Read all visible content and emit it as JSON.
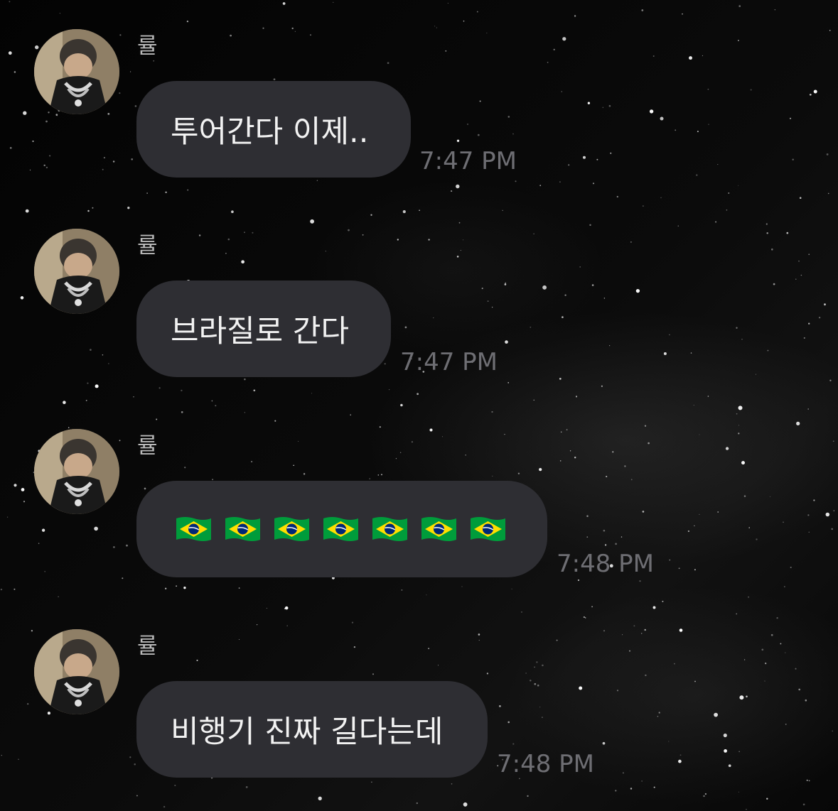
{
  "messages": [
    {
      "sender": "률",
      "text": "투어간다 이제..",
      "time": "7:47 PM"
    },
    {
      "sender": "률",
      "text": "브라질로 간다",
      "time": "7:47 PM"
    },
    {
      "sender": "률",
      "emoji_flags": [
        "flag-brazil-icon",
        "flag-brazil-icon",
        "flag-brazil-icon",
        "flag-brazil-icon",
        "flag-brazil-icon",
        "flag-brazil-icon",
        "flag-brazil-icon"
      ],
      "time": "7:48 PM"
    },
    {
      "sender": "률",
      "text": "비행기 진짜 길다는데",
      "time": "7:48 PM"
    }
  ],
  "colors": {
    "bubble": "#2e2e33",
    "bubble_text": "#f2f2f2",
    "timestamp": "#6e6e73",
    "sender_name": "#b9b9b9",
    "background": "#050505",
    "flag_green": "#009c3b",
    "flag_yellow": "#ffdf00",
    "flag_blue": "#002776"
  }
}
